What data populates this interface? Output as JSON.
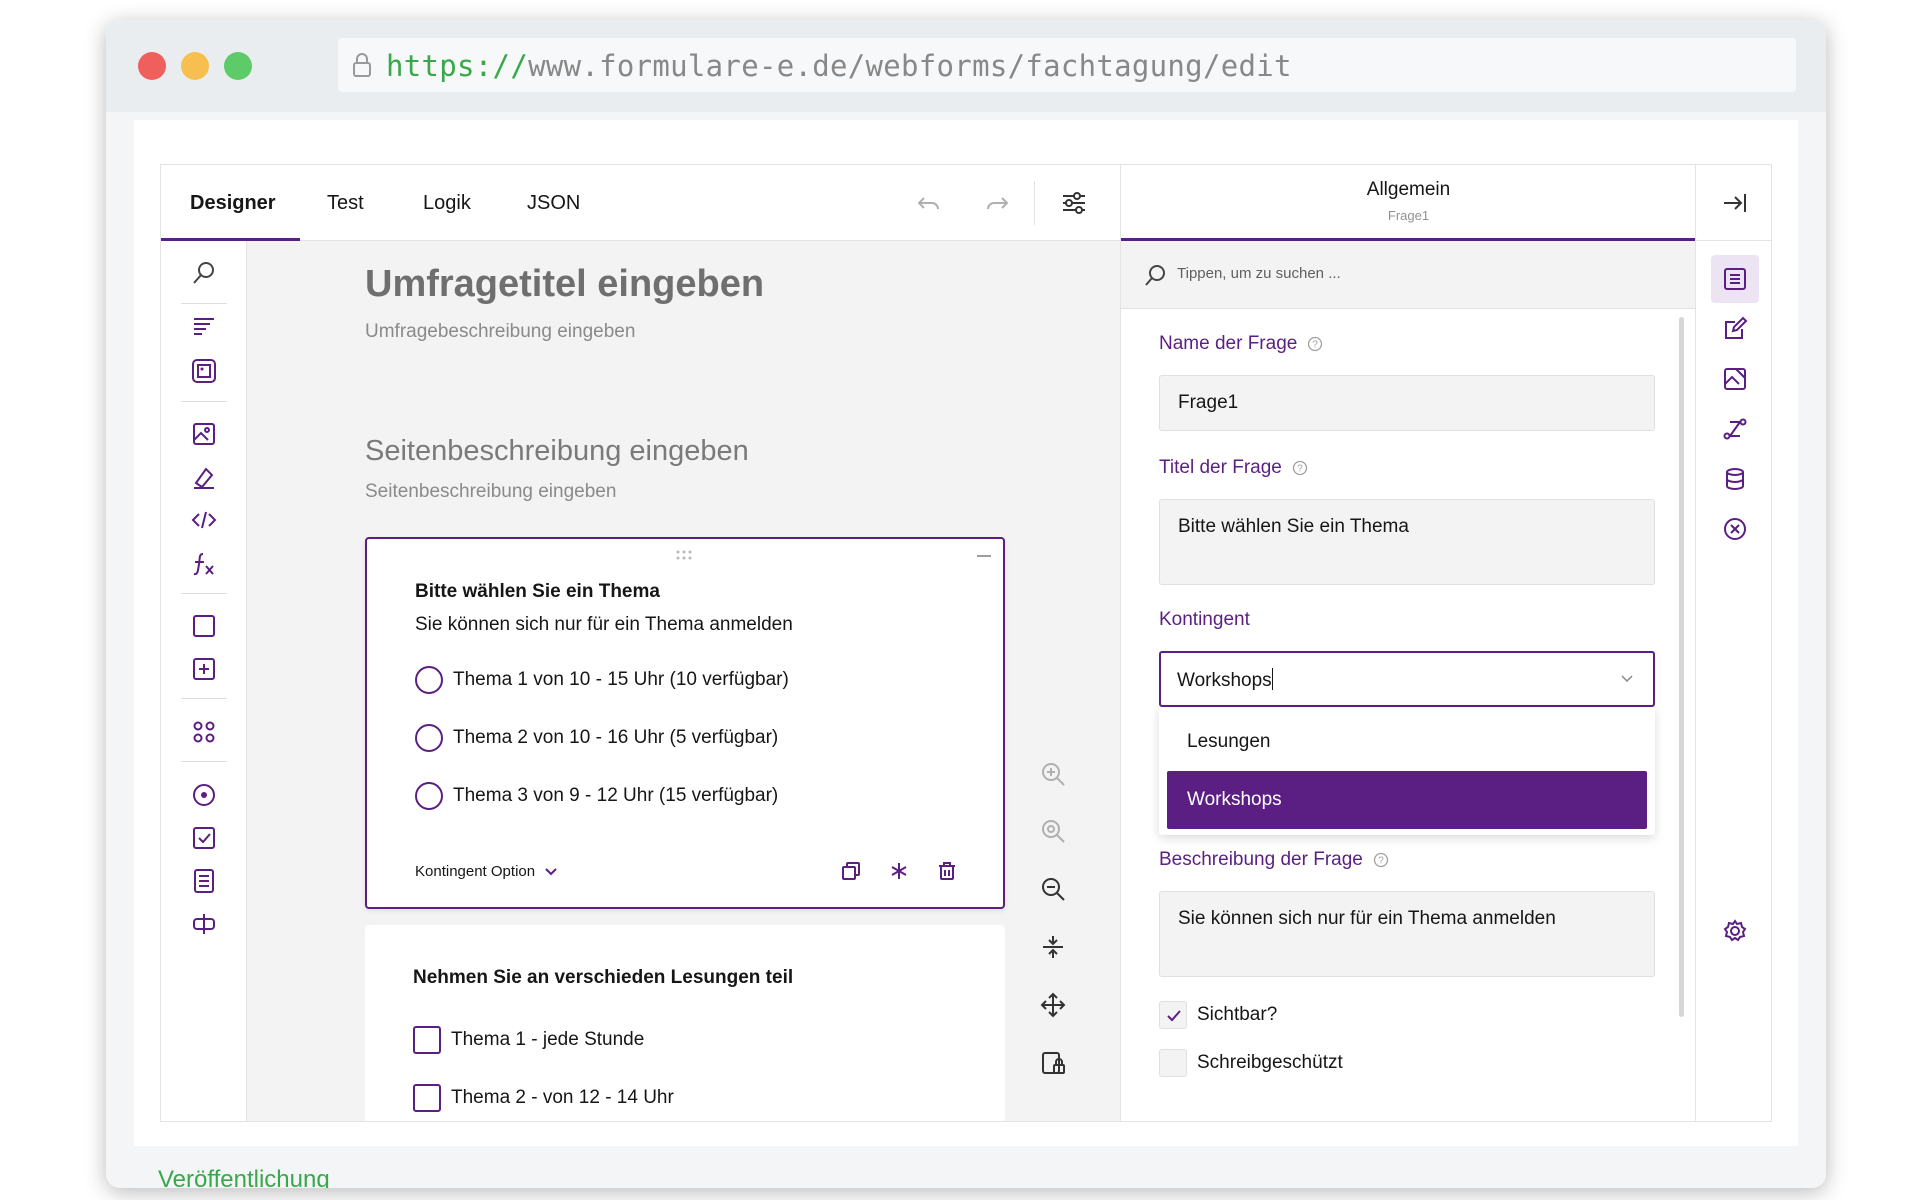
{
  "browser": {
    "url_scheme": "https://",
    "url_rest": "www.formulare-e.de/webforms/fachtagung/edit"
  },
  "tabs": [
    {
      "label": "Designer",
      "active": true
    },
    {
      "label": "Test"
    },
    {
      "label": "Logik"
    },
    {
      "label": "JSON"
    }
  ],
  "canvas": {
    "survey_title": "Umfragetitel eingeben",
    "survey_description": "Umfragebeschreibung eingeben",
    "page_title": "Seitenbeschreibung eingeben",
    "page_description": "Seitenbeschreibung eingeben",
    "question1": {
      "title": "Bitte wählen Sie ein Thema",
      "description": "Sie können sich nur für ein Thema anmelden",
      "choices": [
        "Thema 1 von 10 - 15 Uhr (10 verfügbar)",
        "Thema 2 von 10 - 16 Uhr (5 verfügbar)",
        "Thema 3 von 9 - 12 Uhr (15 verfügbar)"
      ],
      "footer_label": "Kontingent Option"
    },
    "question2": {
      "title": "Nehmen Sie an verschieden Lesungen teil",
      "choices": [
        "Thema 1 - jede Stunde",
        "Thema 2 - von 12 - 14 Uhr"
      ]
    }
  },
  "properties": {
    "header_title": "Allgemein",
    "header_subtitle": "Frage1",
    "search_placeholder": "Tippen, um zu suchen ...",
    "name_label": "Name der Frage",
    "name_value": "Frage1",
    "title_label": "Titel der Frage",
    "title_value": "Bitte wählen Sie ein Thema",
    "kontingent_label": "Kontingent",
    "kontingent_value": "Workshops",
    "kontingent_options": [
      "Lesungen",
      "Workshops"
    ],
    "kontingent_selected": "Workshops",
    "description_label": "Beschreibung der Frage",
    "description_value": "Sie können sich nur für ein Thema anmelden",
    "visible_label": "Sichtbar?",
    "visible_checked": true,
    "readonly_label": "Schreibgeschützt",
    "readonly_checked": false
  },
  "footer": {
    "text": "Veröffentlichung"
  },
  "colors": {
    "accent": "#5b1f84",
    "url_green": "#39a84b"
  }
}
